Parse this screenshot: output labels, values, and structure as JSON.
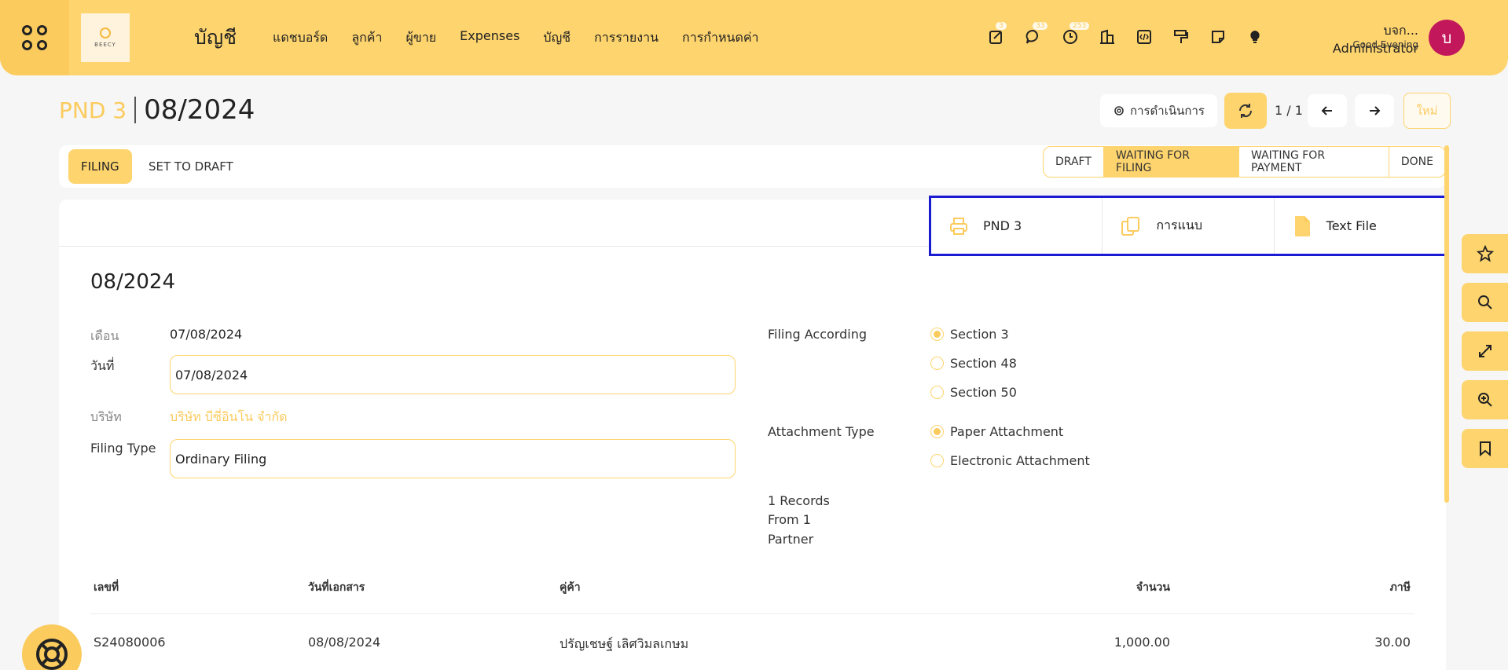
{
  "header": {
    "app_title": "บัญชี",
    "logo_text": "BEECY",
    "nav_items": [
      "แดชบอร์ด",
      "ลูกค้า",
      "ผู้ขาย",
      "Expenses",
      "บัญชี",
      "การรายงาน",
      "การกำหนดค่า"
    ],
    "badges": {
      "activity": "3",
      "messages": "33",
      "clock": "253"
    },
    "user_name": "บจก... Administrator",
    "greeting": "Good Evening",
    "avatar_letter": "บ"
  },
  "control": {
    "breadcrumb_parent": "PND 3",
    "breadcrumb_current": "08/2024",
    "actions_label": "การดำเนินการ",
    "pager": "1 / 1",
    "new_label": "ใหม่"
  },
  "statusbar": {
    "buttons": [
      "FILING",
      "SET TO DRAFT"
    ],
    "stages": [
      "DRAFT",
      "WAITING FOR FILING",
      "WAITING FOR PAYMENT",
      "DONE"
    ],
    "active_stage": "WAITING FOR FILING"
  },
  "smart_buttons": [
    "PND 3",
    "การแนบ",
    "Text File"
  ],
  "form": {
    "title": "08/2024",
    "month_label": "เดือน",
    "month_value": "07/08/2024",
    "date_label": "วันที่",
    "date_value": "07/08/2024",
    "company_label": "บริษัท",
    "company_value": "บริษัท บีซี่อินโน จำกัด",
    "filing_type_label": "Filing Type",
    "filing_type_value": "Ordinary Filing",
    "filing_according_label": "Filing According",
    "filing_according_options": [
      "Section 3",
      "Section 48",
      "Section 50"
    ],
    "filing_according_selected": "Section 3",
    "attachment_type_label": "Attachment Type",
    "attachment_type_options": [
      "Paper Attachment",
      "Electronic Attachment"
    ],
    "attachment_type_selected": "Paper Attachment",
    "summary_lines": [
      "1 Records",
      "From 1",
      "Partner"
    ]
  },
  "table": {
    "headers": [
      "เลขที่",
      "วันที่เอกสาร",
      "คู่ค้า",
      "จำนวน",
      "ภาษี"
    ],
    "rows": [
      [
        "S24080006",
        "08/08/2024",
        "ปรัญเชษฐ์ เลิศวิมลเกษม",
        "1,000.00",
        "30.00"
      ]
    ]
  },
  "colors": {
    "accent": "#fed46e",
    "accent_dark": "#fbcb5e",
    "avatar": "#c2185b",
    "highlight_border": "#1b1bd1"
  },
  "icons": {
    "topbar": [
      "apps-icon",
      "activity-icon",
      "chat-icon",
      "clock-icon",
      "building-icon",
      "code-icon",
      "paint-roller-icon",
      "note-icon",
      "lightbulb-icon"
    ],
    "dock": [
      "star-icon",
      "search-icon",
      "expand-icon",
      "zoom-in-icon",
      "bookmark-icon"
    ]
  }
}
